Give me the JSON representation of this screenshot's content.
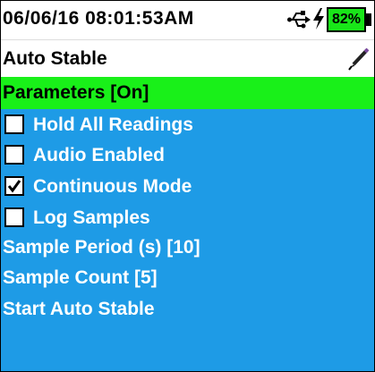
{
  "status": {
    "datetime": "06/06/16  08:01:53AM",
    "battery": "82%"
  },
  "header": {
    "title": "Auto Stable"
  },
  "menu": {
    "section_title": "Parameters [On]",
    "options": [
      {
        "label": "Hold All Readings",
        "checked": false
      },
      {
        "label": "Audio Enabled",
        "checked": false
      },
      {
        "label": "Continuous Mode",
        "checked": true
      },
      {
        "label": "Log Samples",
        "checked": false
      }
    ],
    "items": [
      {
        "label": "Sample Period (s) [10]"
      },
      {
        "label": "Sample Count [5]"
      },
      {
        "label": "Start Auto Stable"
      }
    ]
  },
  "colors": {
    "background": "#1e9be6",
    "highlight": "#19f019",
    "battery": "#19e619"
  }
}
